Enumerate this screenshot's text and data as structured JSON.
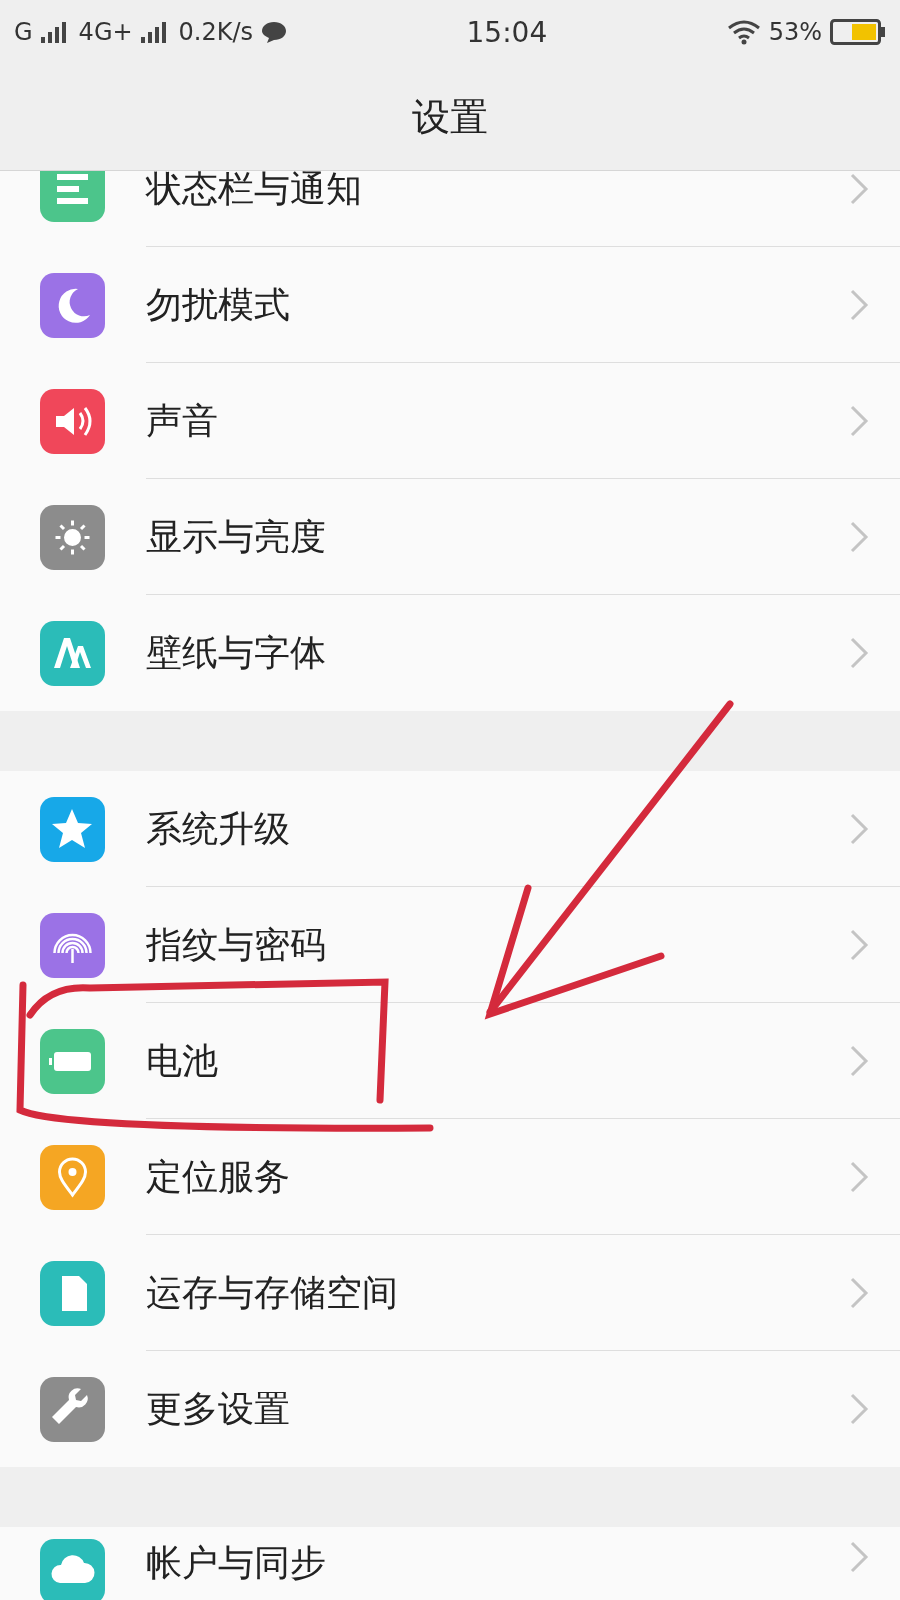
{
  "status_bar": {
    "carrier": "G",
    "network": "4G+",
    "speed": "0.2K/s",
    "time": "15:04",
    "battery": "53%"
  },
  "header": {
    "title": "设置"
  },
  "groups": [
    {
      "items": [
        {
          "label": "状态栏与通知",
          "color": "#4cc58b"
        },
        {
          "label": "勿扰模式",
          "color": "#9b72e6"
        },
        {
          "label": "声音",
          "color": "#f0475a"
        },
        {
          "label": "显示与亮度",
          "color": "#8c8c8c"
        },
        {
          "label": "壁纸与字体",
          "color": "#2bbcb8"
        }
      ]
    },
    {
      "items": [
        {
          "label": "系统升级",
          "color": "#17a8e8"
        },
        {
          "label": "指纹与密码",
          "color": "#9b72e6"
        },
        {
          "label": "电池",
          "color": "#4cc58b"
        },
        {
          "label": "定位服务",
          "color": "#f5a623"
        },
        {
          "label": "运存与存储空间",
          "color": "#2bbcb8"
        },
        {
          "label": "更多设置",
          "color": "#8c8c8c"
        }
      ]
    },
    {
      "items": [
        {
          "label": "帐户与同步",
          "color": "#2bbcb8"
        }
      ]
    }
  ]
}
